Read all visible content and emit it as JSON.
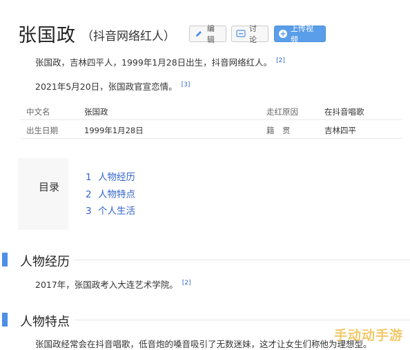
{
  "header": {
    "title": "张国政",
    "subtitle": "（抖音网络红人）",
    "edit_label": "编辑",
    "discuss_label": "讨论",
    "upload_label": "上传视频"
  },
  "summary": [
    {
      "text": "张国政，吉林四平人，1999年1月28日出生，抖音网络红人。",
      "cite": "[2]"
    },
    {
      "text": "2021年5月20日，张国政官宣恋情。",
      "cite": "[3]"
    }
  ],
  "info": [
    {
      "k1": "中文名",
      "v1": "张国政",
      "k2": "走红原因",
      "v2": "在抖音唱歌"
    },
    {
      "k1": "出生日期",
      "v1": "1999年1月28日",
      "k2": "籍　贯",
      "v2": "吉林四平"
    }
  ],
  "toc": {
    "label": "目录",
    "items": [
      {
        "num": "1",
        "text": "人物经历"
      },
      {
        "num": "2",
        "text": "人物特点"
      },
      {
        "num": "3",
        "text": "个人生活"
      }
    ]
  },
  "sections": [
    {
      "title": "人物经历",
      "text": "2017年，张国政考入大连艺术学院。",
      "cite": "[2]"
    },
    {
      "title": "人物特点",
      "text": "张国政经常会在抖音唱歌，低音炮的嗓音吸引了无数迷妹，这才让女生们称他为理想型。",
      "cite": ""
    }
  ],
  "watermark": "手动动手游",
  "colors": {
    "accent": "#4c8fe6",
    "link": "#3366cc",
    "upload_button": "#5a9de8"
  }
}
